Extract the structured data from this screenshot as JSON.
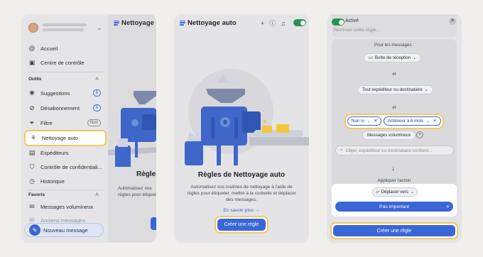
{
  "panel1": {
    "nav": {
      "inbox": "Accueil",
      "control_center": "Centre de contrôle",
      "tools_header": "Outils",
      "suggestions": "Suggestions",
      "suggestions_badge": "6",
      "unsubscribe": "Désabonnement",
      "unsubscribe_badge": "6",
      "filters": "Filtre",
      "filters_badge": "Non",
      "auto_clean": "Nettoyage auto",
      "senders": "Expéditeurs",
      "privacy": "Contrôle de confidentiali...",
      "history": "Historique",
      "favorites_header": "Favoris",
      "large_messages": "Messages volumineux",
      "hidden_item": "Anciens messages"
    },
    "new_message": "Nouveau message",
    "main_title": "Nettoyage",
    "heading": "Règles",
    "description": [
      "Automatisez vos",
      "règles pour étiquet"
    ]
  },
  "panel2": {
    "title": "Nettoyage auto",
    "heading": "Règles de Nettoyage auto",
    "description": [
      "Automatisez vos routines de nettoyage à l'aide de",
      "règles pour étiqueter, mettre à la corbeille et déplacer",
      "des messages."
    ],
    "learn_more": "En savoir plus →",
    "create_button": "Créer une règle"
  },
  "panel3": {
    "active_label": "Activé",
    "rule_name_placeholder": "Nommer cette règle...",
    "for_messages": "Pour les messages :",
    "inbox_pill": "Boîte de réception",
    "and1": "et",
    "sender_pill": "Tout expéditeur ou destinataire",
    "and2": "et",
    "chip_unread": "Non lu",
    "chip_older": "Antérieur à 6 mois",
    "large_pill": "Messages volumineux",
    "search_placeholder": "Objet, expéditeur ou destinataire contient...",
    "apply_action": "Appliquer l'action",
    "move_to": "Déplacer vers",
    "not_important": "Pas important",
    "create_button": "Créer une règle"
  },
  "colors": {
    "accent": "#3b66d6",
    "highlight": "#f3c860",
    "toggle_on": "#2b8f52"
  }
}
